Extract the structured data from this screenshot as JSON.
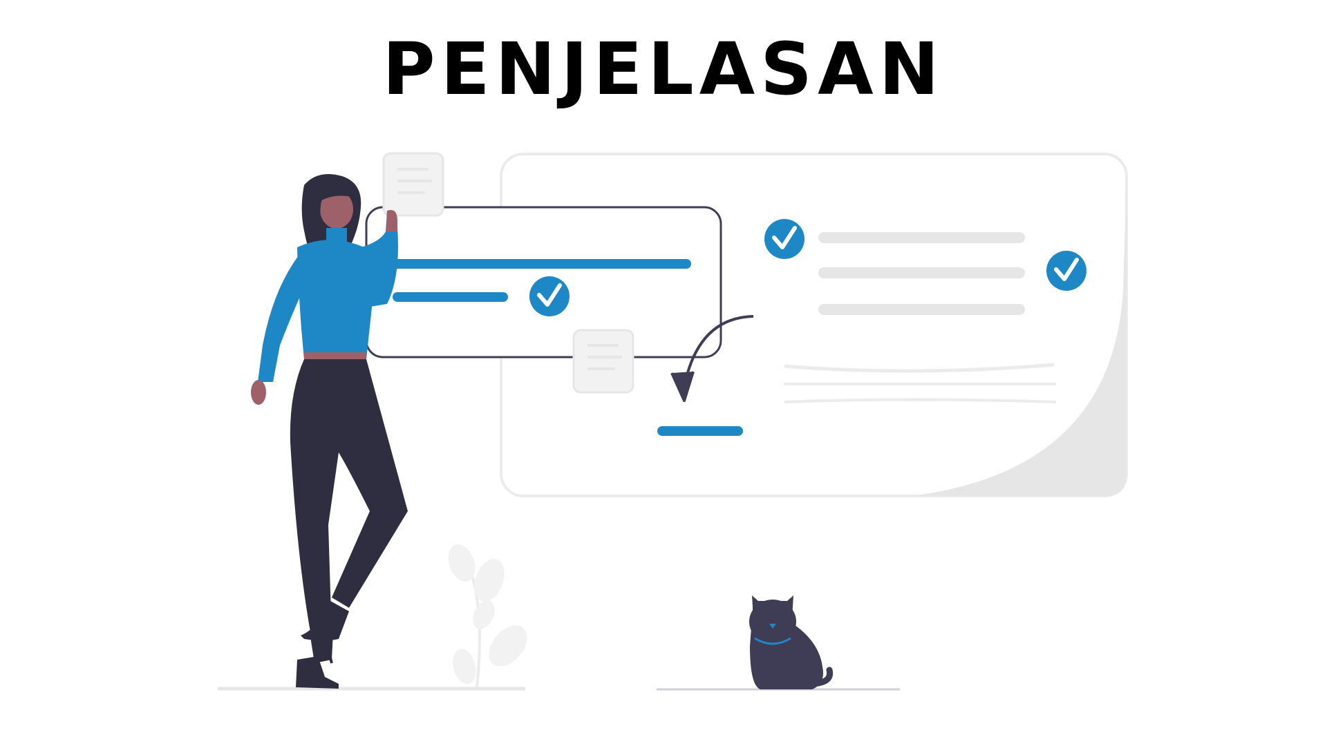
{
  "title": "PENJELASAN",
  "colors": {
    "accent": "#1e88c7",
    "dark": "#2f2e41",
    "skin": "#9e616a",
    "light_gray": "#e6e6e6",
    "panel_border": "#ebebeb"
  },
  "icons": [
    "check-circle-icon",
    "document-icon",
    "curved-arrow-icon",
    "woman-illustration",
    "cat-illustration",
    "plant-illustration"
  ]
}
